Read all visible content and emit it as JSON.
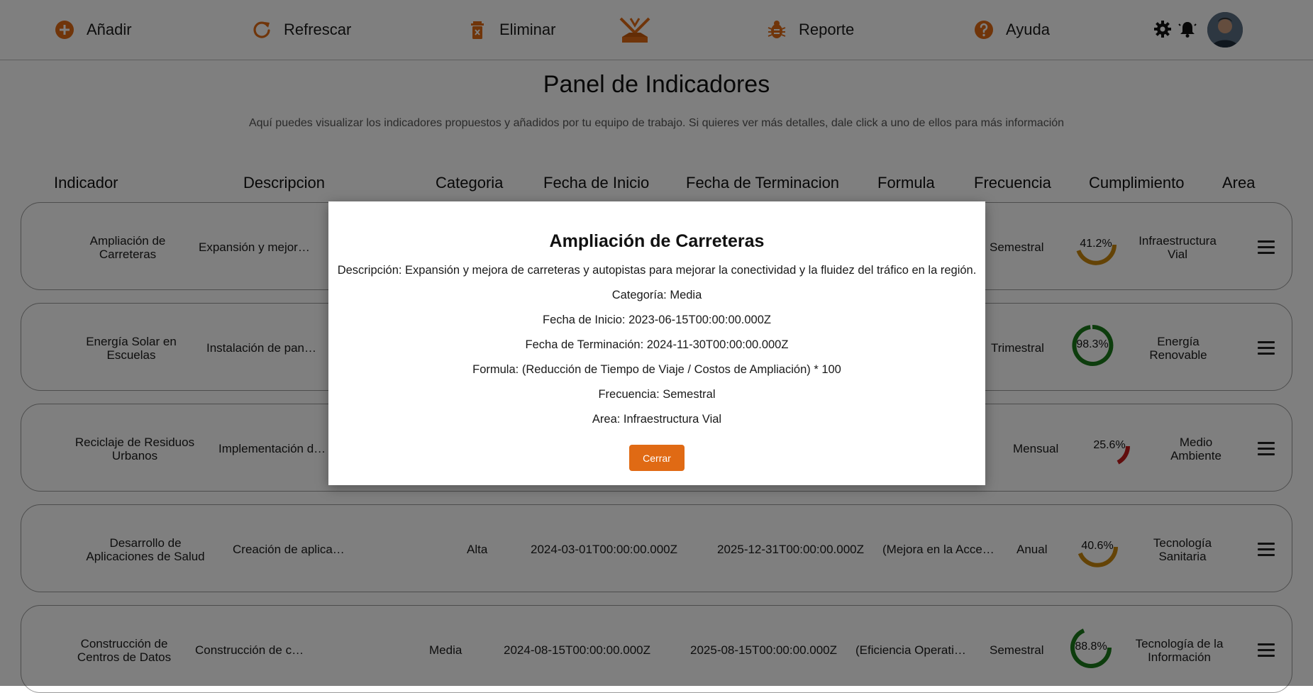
{
  "nav": {
    "add_label": "Añadir",
    "refresh_label": "Refrescar",
    "delete_label": "Eliminar",
    "report_label": "Reporte",
    "help_label": "Ayuda"
  },
  "colors": {
    "accent": "#e06a14",
    "good": "#1b7a1b",
    "warn": "#c8860d",
    "bad": "#c21b1b"
  },
  "header": {
    "title": "Panel de Indicadores",
    "subtitle": "Aquí puedes visualizar los indicadores propuestos y añadidos por tu equipo de trabajo. Si quieres ver más detalles, dale click a uno de ellos para más información"
  },
  "columns": [
    "Indicador",
    "Descripcion",
    "Categoria",
    "Fecha de Inicio",
    "Fecha de Terminacion",
    "Formula",
    "Frecuencia",
    "Cumplimiento",
    "Area"
  ],
  "rows": [
    {
      "name": "Ampliación de Carreteras",
      "description": "Expansión y mejor…",
      "category": "",
      "start": "",
      "end": "",
      "formula": "",
      "frequency": "Semestral",
      "compliance": "41.2%",
      "area": "Infraestructura Vial"
    },
    {
      "name": "Energía Solar en Escuelas",
      "description": "Instalación de pan…",
      "category": "",
      "start": "",
      "end": "",
      "formula": "",
      "frequency": "Trimestral",
      "compliance": "98.3%",
      "area": "Energía Renovable"
    },
    {
      "name": "Reciclaje de Residuos Urbanos",
      "description": "Implementación d…",
      "category": "",
      "start": "",
      "end": "",
      "formula": "",
      "frequency": "Mensual",
      "compliance": "25.6%",
      "area": "Medio Ambiente"
    },
    {
      "name": "Desarrollo de Aplicaciones de Salud",
      "description": "Creación de aplica…",
      "category": "Alta",
      "start": "2024-03-01T00:00:00.000Z",
      "end": "2025-12-31T00:00:00.000Z",
      "formula": "(Mejora en la Acce…",
      "frequency": "Anual",
      "compliance": "40.6%",
      "area": "Tecnología Sanitaria"
    },
    {
      "name": "Construcción de Centros de Datos",
      "description": "Construcción de c…",
      "category": "Media",
      "start": "2024-08-15T00:00:00.000Z",
      "end": "2025-08-15T00:00:00.000Z",
      "formula": "(Eficiencia Operati…",
      "frequency": "Semestral",
      "compliance": "88.8%",
      "area": "Tecnología de la Información"
    }
  ],
  "modal": {
    "title": "Ampliación de Carreteras",
    "description": "Descripción: Expansión y mejora de carreteras y autopistas para mejorar la conectividad y la fluidez del tráfico en la región.",
    "category": "Categoría: Media",
    "start": "Fecha de Inicio: 2023-06-15T00:00:00.000Z",
    "end": "Fecha de Terminación: 2024-11-30T00:00:00.000Z",
    "formula": "Formula: (Reducción de Tiempo de Viaje / Costos de Ampliación) * 100",
    "frequency": "Frecuencia: Semestral",
    "area": "Area: Infraestructura Vial",
    "close_label": "Cerrar"
  }
}
